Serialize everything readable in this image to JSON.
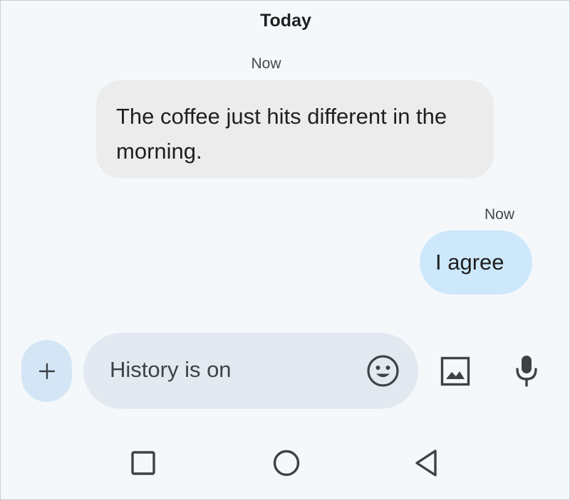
{
  "conversation": {
    "date_header": "Today",
    "messages": [
      {
        "direction": "incoming",
        "timestamp": "Now",
        "text": "The coffee just hits different in the morning."
      },
      {
        "direction": "outgoing",
        "timestamp": "Now",
        "text": "I agree"
      }
    ]
  },
  "composer": {
    "placeholder": "History is on",
    "icons": {
      "attach": "plus-icon",
      "emoji": "emoji-icon",
      "gallery": "image-icon",
      "voice": "mic-icon"
    }
  },
  "nav_bar": {
    "icons": [
      "recents-square-icon",
      "home-circle-icon",
      "back-triangle-icon"
    ]
  },
  "colors": {
    "background": "#f4f8fb",
    "incoming_bubble": "#ececec",
    "outgoing_bubble": "#cde8fb",
    "compose_field": "#e2e9f1",
    "plus_button": "#d4e6f6",
    "icon": "#3d4247"
  }
}
